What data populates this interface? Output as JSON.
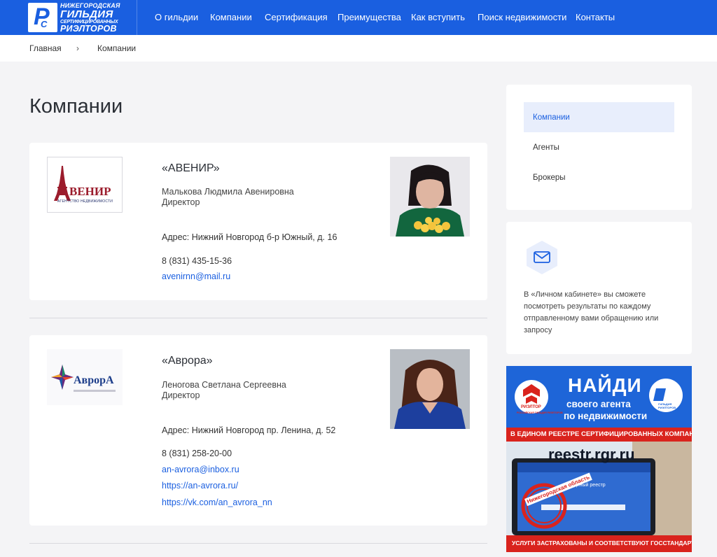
{
  "header": {
    "logo": {
      "line1": "НИЖЕГОРОДСКАЯ",
      "line2": "ГИЛЬДИЯ",
      "line3": "СЕРТИФИЦИРОВАННЫХ",
      "line4": "РИЭЛТОРОВ"
    },
    "nav": [
      {
        "label": "О гильдии"
      },
      {
        "label": "Компании"
      },
      {
        "label": "Сертификация"
      },
      {
        "label": "Преимущества"
      },
      {
        "label": "Как вступить"
      },
      {
        "label": "Поиск недвижимости"
      },
      {
        "label": "Контакты"
      }
    ]
  },
  "breadcrumb": {
    "home": "Главная",
    "separator": "›",
    "current": "Компании"
  },
  "page": {
    "title": "Компании"
  },
  "companies": [
    {
      "name": "«АВЕНИР»",
      "logo_text": "ВЕНИР",
      "logo_subtext": "АГЕНТСТВО НЕДВИЖИМОСТИ",
      "person": "Малькова Людмила Авенировна",
      "role": "Директор",
      "address": "Адрес: Нижний Новгород б-р Южный, д. 16",
      "phone": "8 (831) 435-15-36",
      "email": "avenirnn@mail.ru"
    },
    {
      "name": "«Аврора»",
      "logo_text": "АврорА",
      "person": "Леногова Светлана Сергеевна",
      "role": "Директор",
      "address": "Адрес: Нижний Новгород пр. Ленина, д. 52",
      "phone": "8 (831) 258-20-00",
      "email": "an-avrora@inbox.ru",
      "site": "https://an-avrora.ru/",
      "vk": "https://vk.com/an_avrora_nn"
    }
  ],
  "sidebar": {
    "menu": [
      {
        "label": "Компании",
        "active": true
      },
      {
        "label": "Агенты"
      },
      {
        "label": "Брокеры"
      }
    ],
    "cabinet_text": "В «Личном кабинете» вы сможете посмотреть результаты по каждому отправленному вами обращению или запросу"
  },
  "banner": {
    "headline": "НАЙДИ",
    "sub1": "своего агента",
    "sub2": "по недвижимости",
    "rgr_logo": "РИЭЛТОР",
    "rgr_sub": "РОССИЙСКАЯ ГИЛЬДИЯ РИЭЛТОРОВ",
    "nn_logo": "ГИЛЬДИЯ РИЭЛТОРОВ",
    "strip": "В ЕДИНОМ РЕЕСТРЕ СЕРТИФИЦИРОВАННЫХ КОМПАНИЙ",
    "url": "reestr.rgr.ru",
    "screen_title": "Единый реестр",
    "stamp": "Нижегородская область",
    "footer": "УСЛУГИ ЗАСТРАХОВАНЫ И СООТВЕТСТВУЮТ ГОССТАНДАРТАМ"
  },
  "colors": {
    "brand": "#1a5fe0",
    "link": "#1a5fe0",
    "page_bg": "#f4f4f6",
    "active_bg": "#e8eefc"
  }
}
